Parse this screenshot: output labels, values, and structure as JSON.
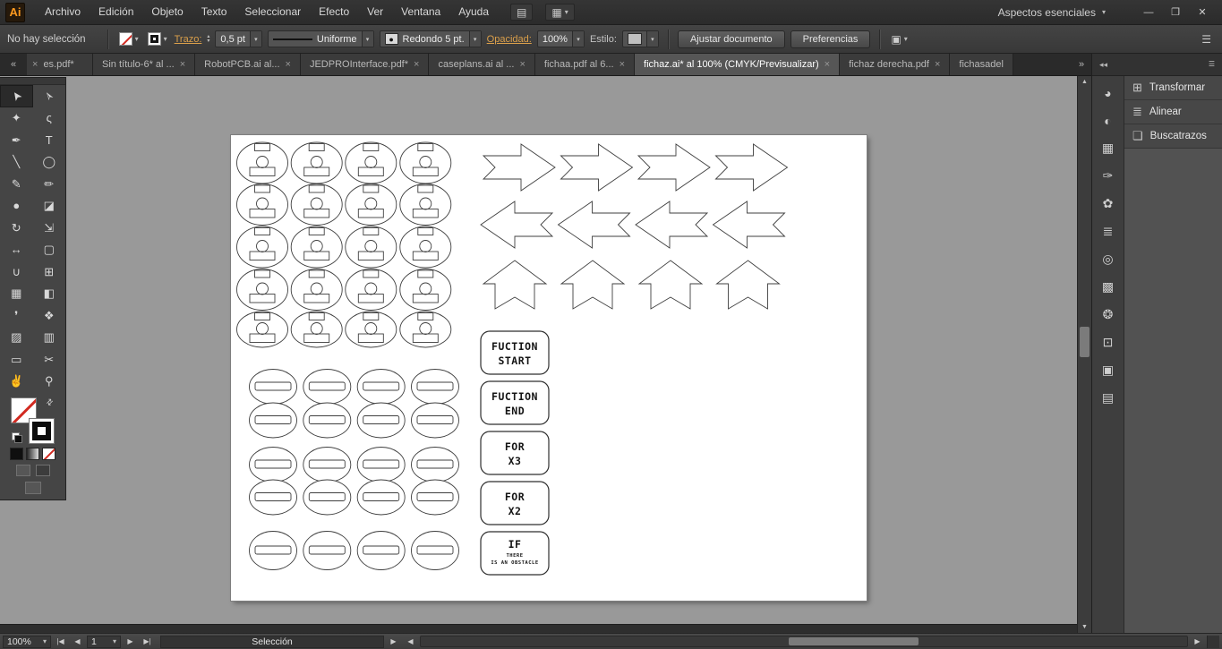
{
  "icons": {
    "chevron": "▾",
    "up_small": "▴",
    "left": "◀",
    "right": "▶",
    "first": "|◀",
    "last": "▶|",
    "scroll_left": "«",
    "overflow": "»",
    "close_tab": "×",
    "swap": "⇄",
    "menu": "☰",
    "select_similar": "▣",
    "bullet": "●",
    "collapse_dock": "◂◂",
    "scroll_up": "▲",
    "scroll_down": "▼"
  },
  "titlebar": {
    "logo": "Ai",
    "menus": [
      "Archivo",
      "Edición",
      "Objeto",
      "Texto",
      "Seleccionar",
      "Efecto",
      "Ver",
      "Ventana",
      "Ayuda"
    ],
    "bridge_icon": "▤",
    "arrange_icon": "▦",
    "workspace": "Aspectos esenciales",
    "minimize": "—",
    "restore": "❐",
    "close": "✕"
  },
  "controlbar": {
    "selection_status": "No hay selección",
    "stroke_label": "Trazo:",
    "stroke_width": "0,5 pt",
    "width_profile": "Uniforme",
    "brush_name": "Redondo 5 pt.",
    "opacity_label": "Opacidad:",
    "opacity_value": "100%",
    "style_label": "Estilo:",
    "fit_document_button": "Ajustar documento",
    "preferences_button": "Preferencias"
  },
  "tabbar": {
    "tabs": [
      {
        "label": "es.pdf*",
        "close_leading": true
      },
      {
        "label": "Sin título-6* al ..."
      },
      {
        "label": "RobotPCB.ai al..."
      },
      {
        "label": "JEDPROInterface.pdf*"
      },
      {
        "label": "caseplans.ai al ..."
      },
      {
        "label": "fichaa.pdf al 6..."
      },
      {
        "label": "fichaz.ai* al 100% (CMYK/Previsualizar)",
        "active": true
      },
      {
        "label": "fichaz derecha.pdf"
      },
      {
        "label": "fichasadel",
        "no_close": true
      }
    ]
  },
  "toolbox": {
    "tools": [
      {
        "name": "selection-tool",
        "glyph": "➤",
        "rot": -125,
        "active": true
      },
      {
        "name": "direct-selection-tool",
        "glyph": "➢",
        "rot": -125
      },
      {
        "name": "magic-wand-tool",
        "glyph": "✦"
      },
      {
        "name": "lasso-tool",
        "glyph": "ς"
      },
      {
        "name": "pen-tool",
        "glyph": "✒"
      },
      {
        "name": "type-tool",
        "glyph": "T"
      },
      {
        "name": "line-segment-tool",
        "glyph": "╲"
      },
      {
        "name": "ellipse-tool",
        "glyph": "◯"
      },
      {
        "name": "paintbrush-tool",
        "glyph": "✎"
      },
      {
        "name": "pencil-tool",
        "glyph": "✏"
      },
      {
        "name": "blob-brush-tool",
        "glyph": "●"
      },
      {
        "name": "eraser-tool",
        "glyph": "◪"
      },
      {
        "name": "rotate-tool",
        "glyph": "↻"
      },
      {
        "name": "scale-tool",
        "glyph": "⇲"
      },
      {
        "name": "width-tool",
        "glyph": "↔"
      },
      {
        "name": "free-transform-tool",
        "glyph": "▢"
      },
      {
        "name": "shape-builder-tool",
        "glyph": "∪"
      },
      {
        "name": "perspective-grid-tool",
        "glyph": "⊞"
      },
      {
        "name": "mesh-tool",
        "glyph": "▦"
      },
      {
        "name": "gradient-tool",
        "glyph": "◧"
      },
      {
        "name": "eyedropper-tool",
        "glyph": "❜"
      },
      {
        "name": "blend-tool",
        "glyph": "❖"
      },
      {
        "name": "symbol-sprayer-tool",
        "glyph": "▨"
      },
      {
        "name": "column-graph-tool",
        "glyph": "▥"
      },
      {
        "name": "artboard-tool",
        "glyph": "▭"
      },
      {
        "name": "slice-tool",
        "glyph": "✂"
      },
      {
        "name": "hand-tool",
        "glyph": "✌"
      },
      {
        "name": "zoom-tool",
        "glyph": "⚲"
      }
    ]
  },
  "dock": {
    "icons": [
      {
        "name": "color-panel",
        "glyph": "◕"
      },
      {
        "name": "color-guide-panel",
        "glyph": "◐"
      },
      {
        "name": "swatches-panel",
        "glyph": "▦"
      },
      {
        "name": "brushes-panel",
        "glyph": "✑"
      },
      {
        "name": "symbols-panel",
        "glyph": "✿"
      },
      {
        "name": "stroke-panel",
        "glyph": "≣"
      },
      {
        "name": "gradient-panel",
        "glyph": "◎"
      },
      {
        "name": "transparency-panel",
        "glyph": "▩"
      },
      {
        "name": "appearance-panel",
        "glyph": "❂"
      },
      {
        "name": "graphic-styles-panel",
        "glyph": "⊡"
      },
      {
        "name": "layers-panel",
        "glyph": "▣"
      },
      {
        "name": "artboards-panel",
        "glyph": "▤"
      }
    ],
    "panels": [
      {
        "name": "transform-panel",
        "icon": "⊞",
        "label": "Transformar"
      },
      {
        "name": "align-panel",
        "icon": "≣",
        "label": "Alinear"
      },
      {
        "name": "pathfinder-panel",
        "icon": "❏",
        "label": "Buscatrazos"
      }
    ]
  },
  "statusbar": {
    "zoom": "100%",
    "artboard_number": "1",
    "status_text": "Selección"
  },
  "artboard": {
    "function_buttons": [
      {
        "lines": [
          "FUCTION",
          "START"
        ]
      },
      {
        "lines": [
          "FUCTION",
          "END"
        ]
      },
      {
        "lines": [
          "FOR",
          "X3"
        ]
      },
      {
        "lines": [
          "FOR",
          "X2"
        ]
      },
      {
        "lines": [
          "IF",
          "THERE",
          "IS AN OBSTACLE"
        ]
      }
    ],
    "arrow_rows": [
      {
        "dir": "right",
        "count": 4
      },
      {
        "dir": "left",
        "count": 4
      },
      {
        "dir": "up",
        "count": 4
      }
    ],
    "connector_pieces": {
      "rows": 5,
      "cols": 4
    },
    "slot_pieces": {
      "rows": 5,
      "cols": 4
    }
  }
}
